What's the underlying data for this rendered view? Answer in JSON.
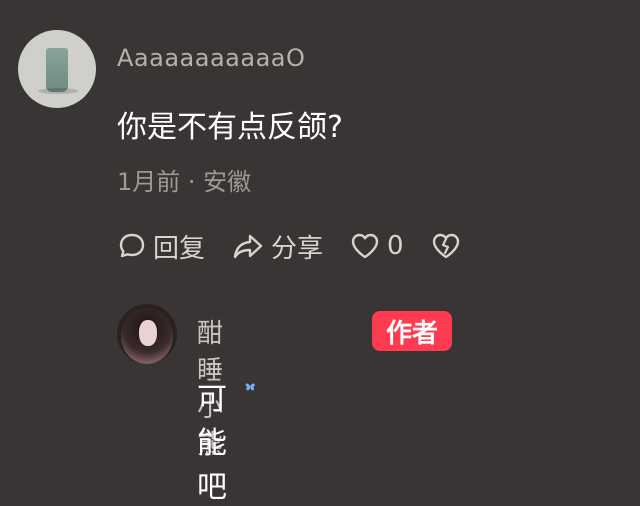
{
  "comment": {
    "username": "AaaaaaaaaaaO",
    "text": "你是不有点反颌?",
    "meta": "1月前 · 安徽",
    "actions": {
      "reply_label": "回复",
      "share_label": "分享",
      "like_count": "0"
    }
  },
  "reply": {
    "username": "酣睡小熊",
    "badge": "作者",
    "text": "可能吧"
  },
  "colors": {
    "background": "#3a3535",
    "author_badge": "#ff3b52",
    "butterfly": "#6fb7ff"
  }
}
